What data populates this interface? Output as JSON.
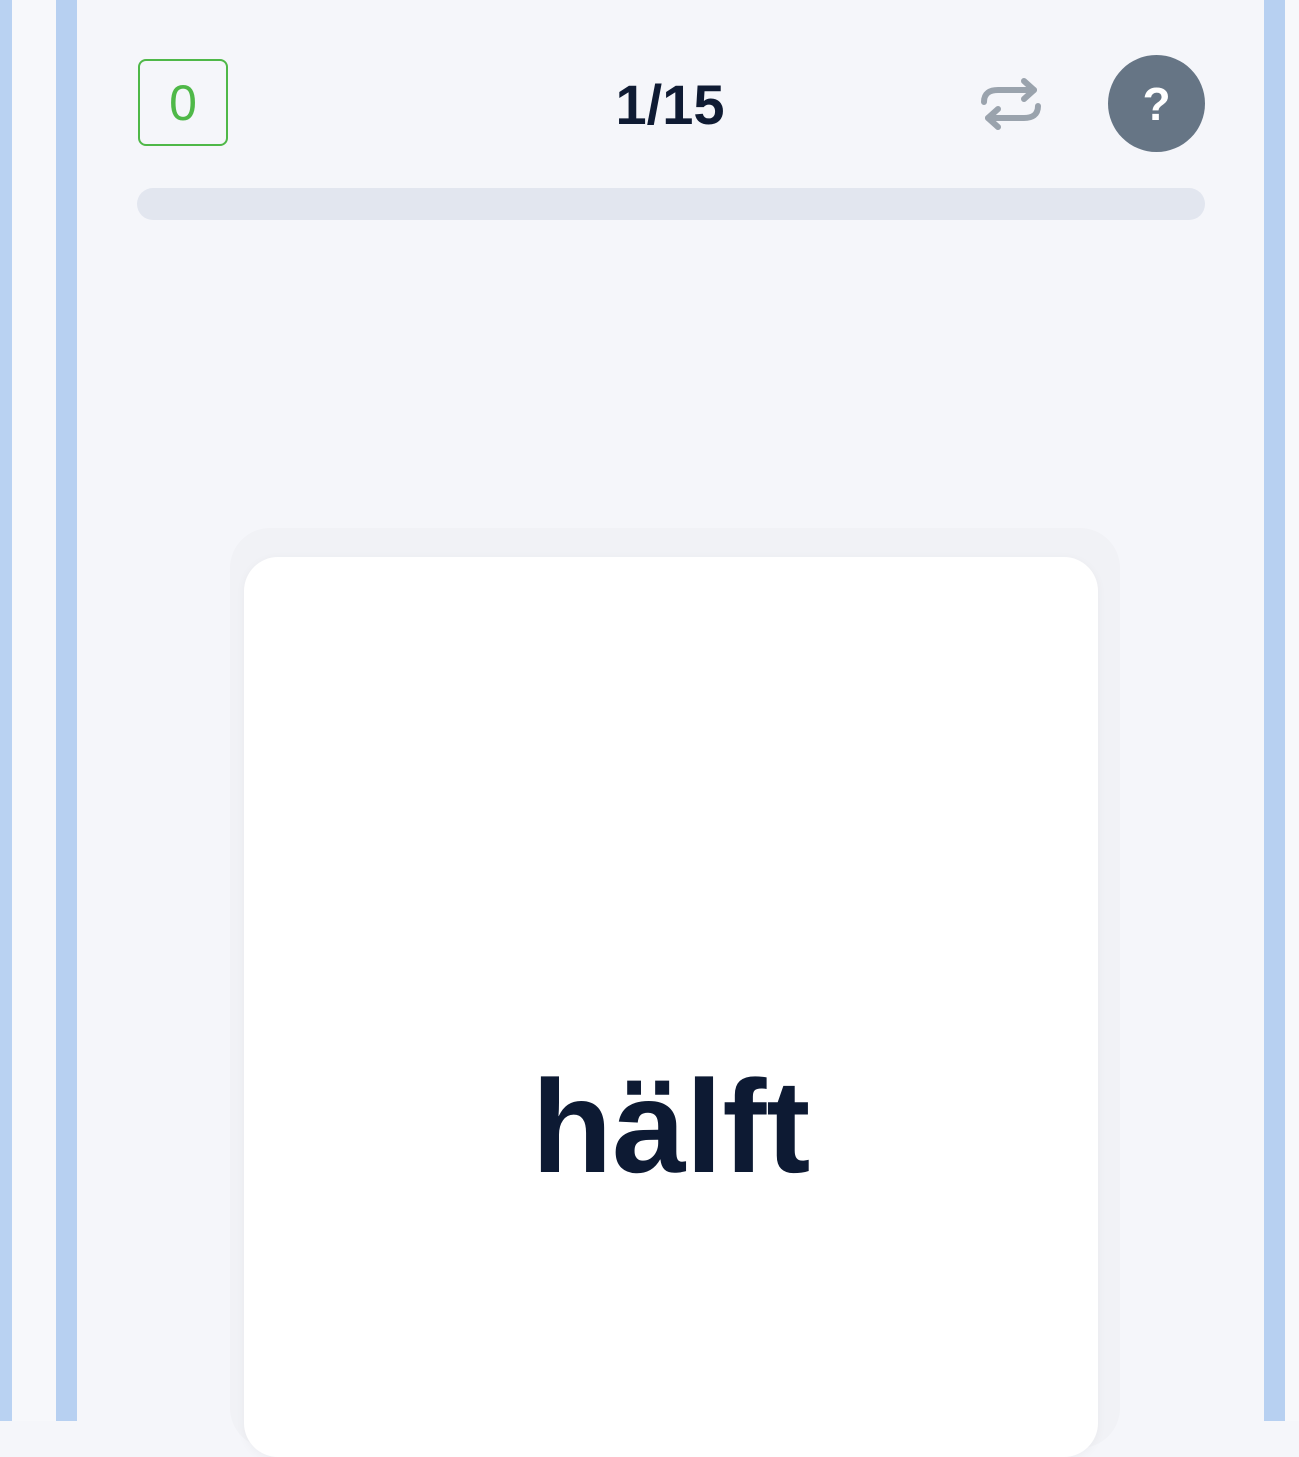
{
  "header": {
    "score": "0",
    "counter": "1/15",
    "help_label": "?"
  },
  "progress": {
    "current": 1,
    "total": 15,
    "fill_fraction": 0
  },
  "card": {
    "word": "hälft"
  },
  "icons": {
    "repeat": "repeat-icon",
    "help": "question-mark-icon"
  },
  "colors": {
    "score_green": "#4fb848",
    "help_bg": "#667585",
    "frame_blue": "#b7d0f1",
    "text_dark": "#0f1b33",
    "track": "#e2e6ef"
  }
}
